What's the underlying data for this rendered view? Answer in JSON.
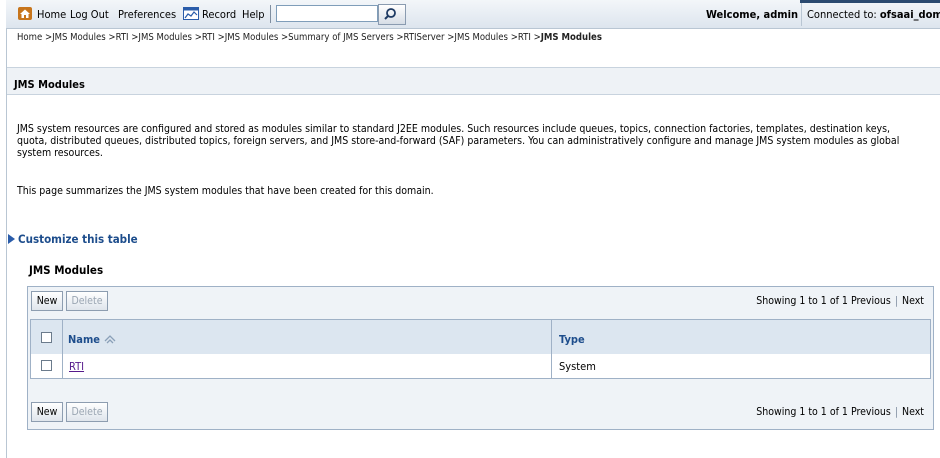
{
  "topbar": {
    "home_label": "Home",
    "logout_label": "Log Out",
    "preferences_label": "Preferences",
    "record_label": "Record",
    "help_label": "Help",
    "search_value": "",
    "welcome_text": "Welcome, admin",
    "connected_prefix": "Connected to: ",
    "connected_domain": "ofsaai_doma"
  },
  "breadcrumb": {
    "path": "Home >JMS Modules >RTI >JMS Modules >RTI >JMS Modules >Summary of JMS Servers >RTIServer >JMS Modules >RTI >",
    "current": "JMS Modules"
  },
  "page": {
    "title": "JMS Modules",
    "description": "JMS system resources are configured and stored as modules similar to standard J2EE modules. Such resources include queues, topics, connection factories, templates, destination keys, quota, distributed queues, distributed topics, foreign servers, and JMS store-and-forward (SAF) parameters. You can administratively configure and manage JMS system modules as global system resources.",
    "summary": "This page summarizes the JMS system modules that have been created for this domain.",
    "customize_label": "Customize this table",
    "section_title": "JMS Modules"
  },
  "table": {
    "new_label": "New",
    "delete_label": "Delete",
    "showing_text": "Showing 1 to 1 of 1",
    "previous_label": "Previous",
    "next_label": "Next",
    "columns": {
      "name": "Name",
      "type": "Type"
    },
    "rows": [
      {
        "name": "RTI",
        "type": "System"
      }
    ]
  },
  "colors": {
    "accent_link": "#1d4d8c",
    "header_bg": "#dce6f0",
    "visited_link": "#551a8b"
  }
}
